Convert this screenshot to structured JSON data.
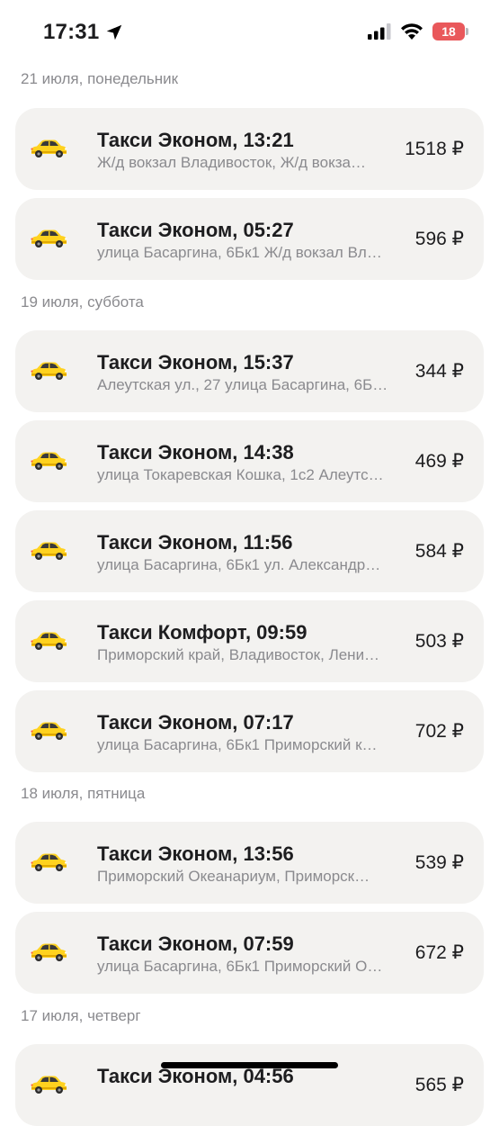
{
  "status_bar": {
    "time": "17:31",
    "battery": "18"
  },
  "colors": {
    "taxi_yellow": "#ffd21f",
    "card_bg": "#f3f2f0",
    "secondary_text": "#8a8a8e",
    "battery_red": "#e9585b"
  },
  "icons": {
    "location": "location-arrow-icon",
    "signal": "cellular-signal-icon",
    "wifi": "wifi-icon",
    "car": "taxi-car-icon"
  },
  "groups": [
    {
      "date": "21 июля, понедельник",
      "rides": [
        {
          "title": "Такси Эконом, 13:21",
          "route": "Ж/д вокзал Владивосток, Ж/д вокза…",
          "price": "1518 ₽"
        },
        {
          "title": "Такси Эконом, 05:27",
          "route": "улица Басаргина, 6Бк1 Ж/д вокзал Вл…",
          "price": "596 ₽"
        }
      ]
    },
    {
      "date": "19 июля, суббота",
      "rides": [
        {
          "title": "Такси Эконом, 15:37",
          "route": "Алеутская ул., 27 улица Басаргина, 6Б…",
          "price": "344 ₽"
        },
        {
          "title": "Такси Эконом, 14:38",
          "route": "улица Токаревская Кошка, 1с2 Алеутс…",
          "price": "469 ₽"
        },
        {
          "title": "Такси Эконом, 11:56",
          "route": "улица Басаргина, 6Бк1 ул. Александр…",
          "price": "584 ₽"
        },
        {
          "title": "Такси Комфорт, 09:59",
          "route": "Приморский край, Владивосток, Лени…",
          "price": "503 ₽"
        },
        {
          "title": "Такси Эконом, 07:17",
          "route": "улица Басаргина, 6Бк1 Приморский к…",
          "price": "702 ₽"
        }
      ]
    },
    {
      "date": "18 июля, пятница",
      "rides": [
        {
          "title": "Такси Эконом, 13:56",
          "route": "Приморский Океанариум, Приморск…",
          "price": "539 ₽"
        },
        {
          "title": "Такси Эконом, 07:59",
          "route": "улица Басаргина, 6Бк1 Приморский О…",
          "price": "672 ₽"
        }
      ]
    },
    {
      "date": "17 июля, четверг",
      "rides": [
        {
          "title": "Такси Эконом, 04:56",
          "route": "",
          "price": "565 ₽"
        }
      ]
    }
  ]
}
